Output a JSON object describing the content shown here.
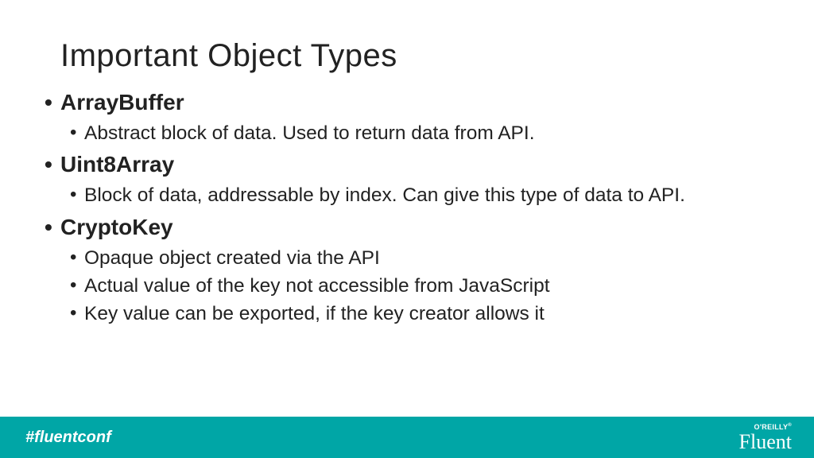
{
  "title": "Important Object Types",
  "items": [
    {
      "name": "ArrayBuffer",
      "subs": [
        "Abstract block of data. Used to return data from API."
      ]
    },
    {
      "name": "Uint8Array",
      "subs": [
        "Block of data, addressable by index. Can give this type of data to API."
      ]
    },
    {
      "name": "CryptoKey",
      "subs": [
        "Opaque object created via the API",
        "Actual value of the key not accessible from JavaScript",
        "Key value can be exported, if the key creator allows it"
      ]
    }
  ],
  "footer": {
    "hashtag": "#fluentconf",
    "oreilly": "O'REILLY",
    "reg": "®",
    "fluent": "Fluent"
  }
}
